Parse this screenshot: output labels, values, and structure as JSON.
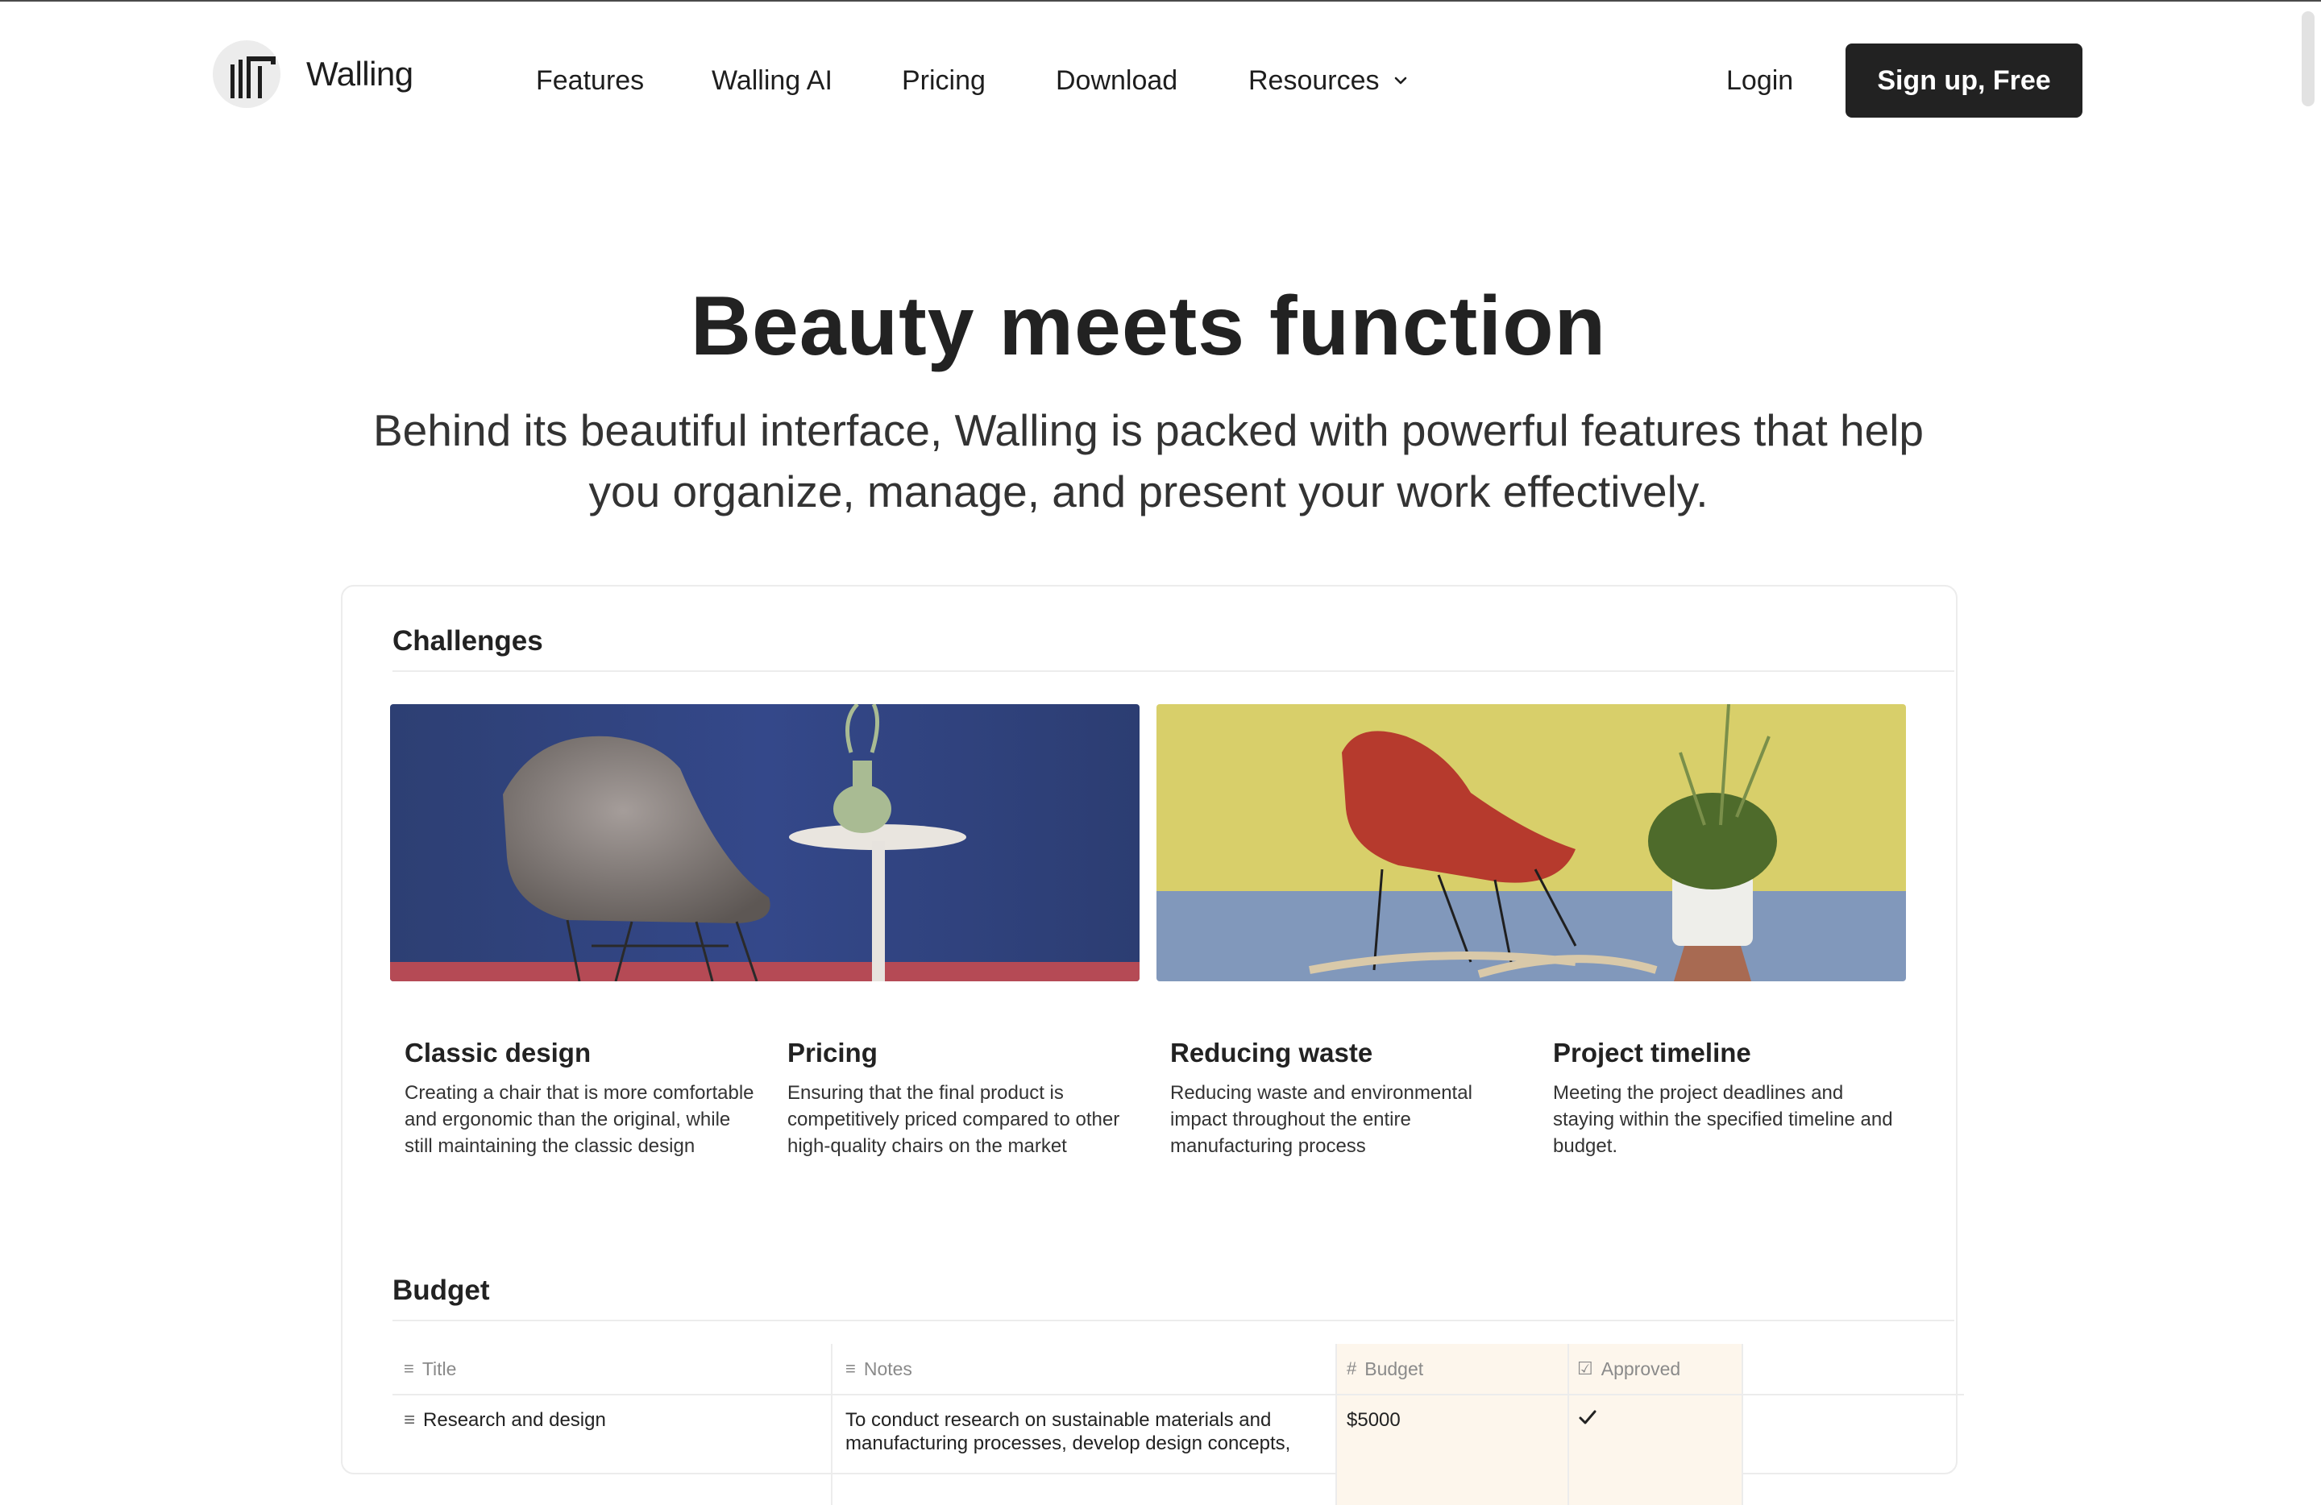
{
  "brand": {
    "name": "Walling",
    "logo_icon": "walling-logo-icon"
  },
  "nav": {
    "items": [
      {
        "label": "Features"
      },
      {
        "label": "Walling AI"
      },
      {
        "label": "Pricing"
      },
      {
        "label": "Download"
      },
      {
        "label": "Resources",
        "icon": "chevron-down-icon"
      }
    ],
    "login": "Login",
    "signup": "Sign up, Free"
  },
  "hero": {
    "title": "Beauty meets function",
    "subtitle": "Behind its beautiful interface, Walling is packed with powerful features that help you organize, manage, and present your work effectively."
  },
  "challenges": {
    "title": "Challenges",
    "images": [
      {
        "name": "grey-armchair-photo"
      },
      {
        "name": "red-rocking-chair-photo"
      }
    ],
    "features": [
      {
        "title": "Classic design",
        "text": "Creating a chair that is more comfortable and ergonomic than the original, while still maintaining the classic design"
      },
      {
        "title": "Pricing",
        "text": "Ensuring that the final product is competitively priced compared to other high-quality chairs on the market"
      },
      {
        "title": "Reducing waste",
        "text": "Reducing waste and environmental impact throughout the entire manufacturing process"
      },
      {
        "title": "Project timeline",
        "text": "Meeting the project deadlines and staying within the specified timeline and budget."
      }
    ]
  },
  "budget": {
    "title": "Budget",
    "columns": [
      {
        "label": "Title",
        "icon": "text-lines-icon"
      },
      {
        "label": "Notes",
        "icon": "text-lines-icon"
      },
      {
        "label": "Budget",
        "icon": "hash-icon"
      },
      {
        "label": "Approved",
        "icon": "checkbox-icon"
      }
    ],
    "rows": [
      {
        "title": "Research and design",
        "notes": "To conduct research on sustainable materials and manufacturing processes, develop design concepts,",
        "currency": "$",
        "budget": "5000",
        "approved": true
      }
    ]
  },
  "colors": {
    "accent": "#222222",
    "budget_column": "#fdf6ec",
    "border": "#ececec"
  }
}
